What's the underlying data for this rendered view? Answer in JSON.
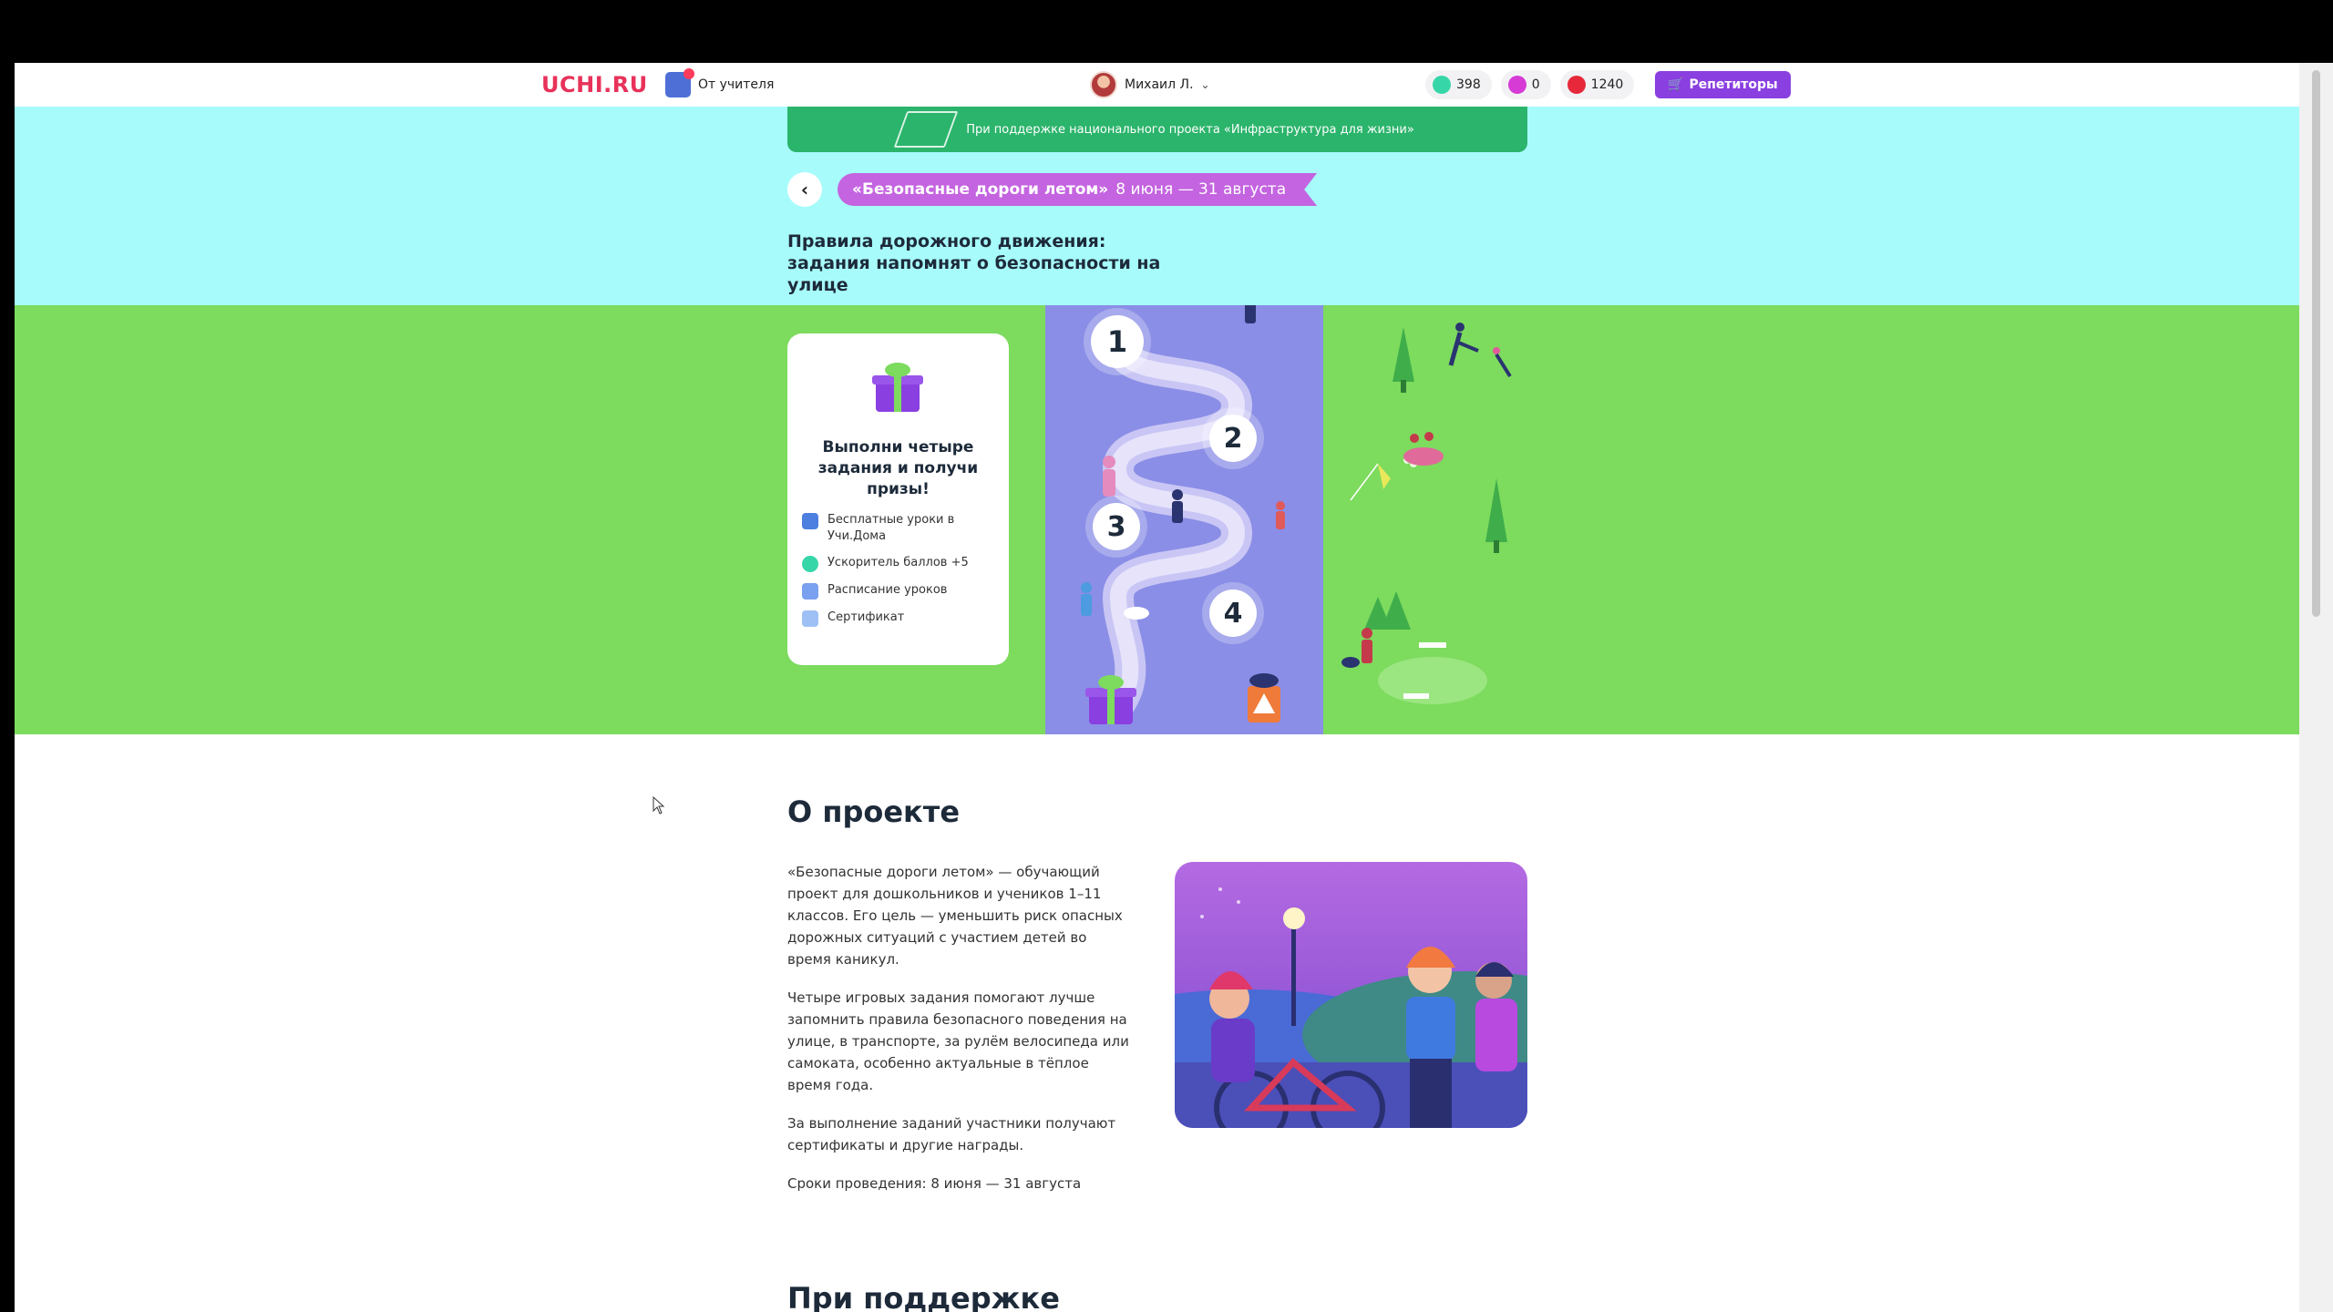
{
  "header": {
    "logo": "UCHI.RU",
    "teacher_link": "От учителя",
    "user_name": "Михаил Л.",
    "stats": [
      {
        "value": "398",
        "color": "#37d6a8",
        "icon": "crystal-green-icon"
      },
      {
        "value": "0",
        "color": "#d63bd6",
        "icon": "crystal-pink-icon"
      },
      {
        "value": "1240",
        "color": "#e6283a",
        "icon": "crystal-red-icon"
      }
    ],
    "tutor_button": "Репетиторы"
  },
  "banner": {
    "text": "При поддержке национального проекта «Инфраструктура для жизни»"
  },
  "ribbon": {
    "title": "«Безопасные дороги летом»",
    "dates": "8 июня — 31 августа"
  },
  "hero": {
    "title": "Правила дорожного движения: задания напомнят о безопасности на улице"
  },
  "prize_card": {
    "title": "Выполни четыре задания и получи призы!",
    "items": [
      {
        "label": "Бесплатные уроки в Учи.Дома",
        "icon": "lessons-icon",
        "color": "#4d7fe0"
      },
      {
        "label": "Ускоритель баллов +5",
        "icon": "booster-icon",
        "color": "#37d6a8"
      },
      {
        "label": "Расписание уроков",
        "icon": "schedule-icon",
        "color": "#7aa0f0"
      },
      {
        "label": "Сертификат",
        "icon": "certificate-icon",
        "color": "#9ec0f5"
      }
    ]
  },
  "steps": [
    "1",
    "2",
    "3",
    "4"
  ],
  "about": {
    "title": "О проекте",
    "paragraphs": [
      "«Безопасные дороги летом» — обучающий проект для дошкольников и учеников 1–11 классов. Его цель — уменьшить риск опасных дорожных ситуаций с участием детей во время каникул.",
      "Четыре игровых задания помогают лучше запомнить правила безопасного поведения на улице, в транспорте, за рулём велосипеда или самоката, особенно актуальные в тёплое время года.",
      "За выполнение заданий участники получают сертификаты и другие награды.",
      "Сроки проведения: 8 июня — 31 августа"
    ]
  },
  "support_title": "При поддержке",
  "colors": {
    "sky": "#a7fbfb",
    "grass": "#7ddb5e",
    "road": "#8a8ee6",
    "accent_purple": "#8a3fe0",
    "banner_green": "#2bb46b",
    "logo_red": "#e8325a"
  }
}
